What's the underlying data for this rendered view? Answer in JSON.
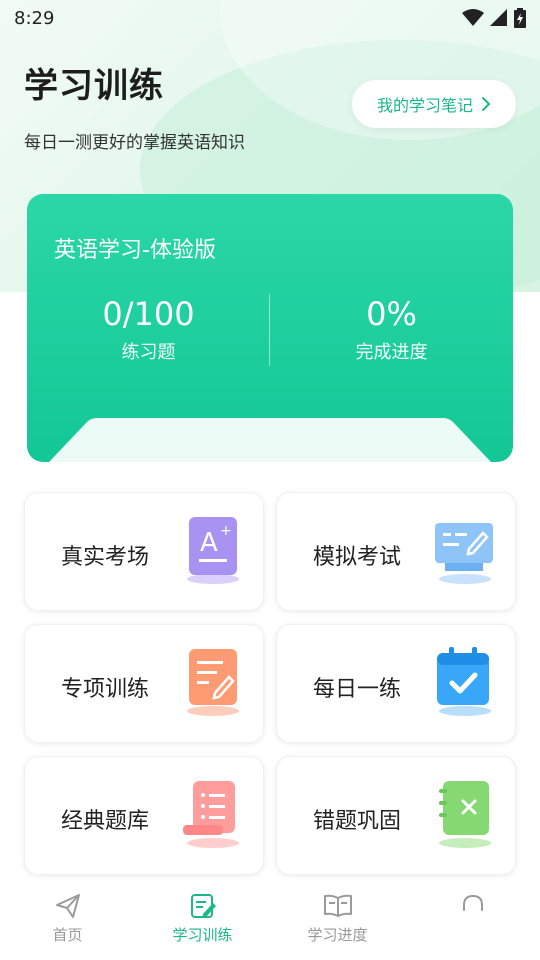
{
  "status_bar": {
    "time": "8:29"
  },
  "header": {
    "title": "学习训练",
    "subtitle": "每日一测更好的掌握英语知识",
    "notes_button": "我的学习笔记"
  },
  "course_card": {
    "name": "英语学习-体验版",
    "stats": [
      {
        "value": "0/100",
        "label": "练习题"
      },
      {
        "value": "0%",
        "label": "完成进度"
      }
    ]
  },
  "tiles": [
    {
      "label": "真实考场",
      "icon": "exam-paper-icon",
      "color": "#a48ff0"
    },
    {
      "label": "模拟考试",
      "icon": "computer-edit-icon",
      "color": "#6ab0f5"
    },
    {
      "label": "专项训练",
      "icon": "document-edit-icon",
      "color": "#ff8a62"
    },
    {
      "label": "每日一练",
      "icon": "calendar-check-icon",
      "color": "#35a4f5"
    },
    {
      "label": "经典题库",
      "icon": "scroll-list-icon",
      "color": "#ff8d8d"
    },
    {
      "label": "错题巩固",
      "icon": "notebook-x-icon",
      "color": "#78d66a"
    }
  ],
  "tabbar": {
    "items": [
      {
        "label": "首页",
        "icon": "paper-plane-icon",
        "active": false
      },
      {
        "label": "学习训练",
        "icon": "edit-note-icon",
        "active": true
      },
      {
        "label": "学习进度",
        "icon": "open-book-icon",
        "active": false
      },
      {
        "label": "",
        "icon": "headset-icon",
        "active": false
      }
    ]
  },
  "colors": {
    "accent": "#19b886",
    "card_top": "#2bd7a6",
    "card_bottom": "#13c796"
  }
}
